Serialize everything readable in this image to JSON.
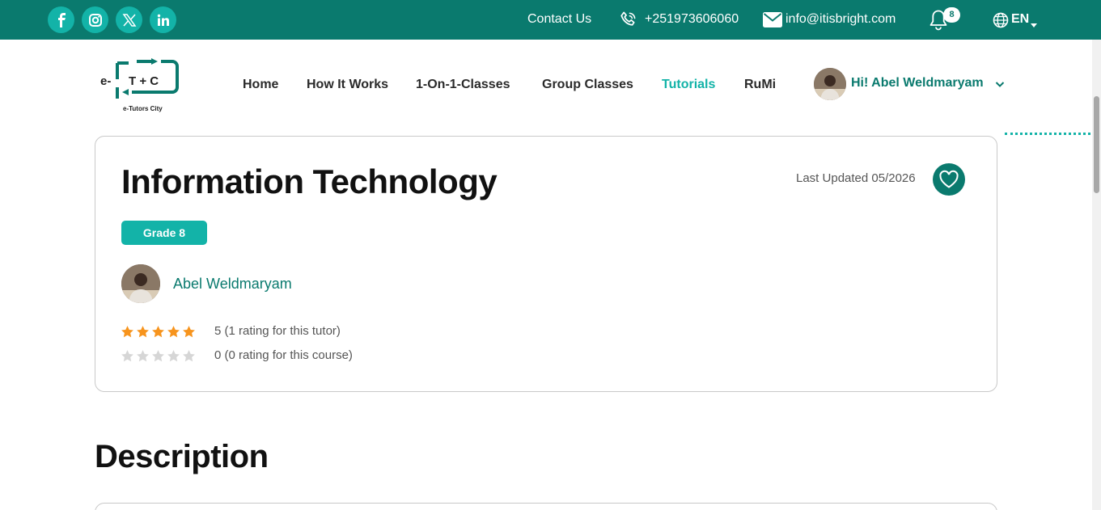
{
  "header": {
    "social": [
      "facebook-icon",
      "instagram-icon",
      "x-icon",
      "linkedin-icon"
    ],
    "contact_label": "Contact Us",
    "phone": "+251973606060",
    "email": "info@itisbright.com",
    "notification_count": "8",
    "language": "EN"
  },
  "logo": {
    "mark": "T + C",
    "prefix": "e-",
    "caption": "e-Tutors City"
  },
  "nav": {
    "items": [
      {
        "label": "Home"
      },
      {
        "label": "How It Works"
      },
      {
        "label": "1-On-1-Classes"
      },
      {
        "label": "Group Classes"
      },
      {
        "label": "Tutorials"
      },
      {
        "label": "RuMi"
      }
    ],
    "active": "Tutorials",
    "greeting": "Hi! Abel Weldmaryam"
  },
  "course": {
    "title": "Information Technology",
    "last_updated": "Last Updated 05/2026",
    "grade": "Grade 8",
    "tutor_name": "Abel Weldmaryam",
    "tutor_rating": 5,
    "tutor_rating_text": "5 (1 rating for this tutor)",
    "course_rating": 0,
    "course_rating_text": "0 (0 rating for this course)"
  },
  "sections": {
    "description_title": "Description"
  },
  "colors": {
    "brand": "#0a7a6e",
    "accent": "#13b3a8",
    "star_filled": "#f7941d",
    "star_empty": "#d6d6d6"
  }
}
